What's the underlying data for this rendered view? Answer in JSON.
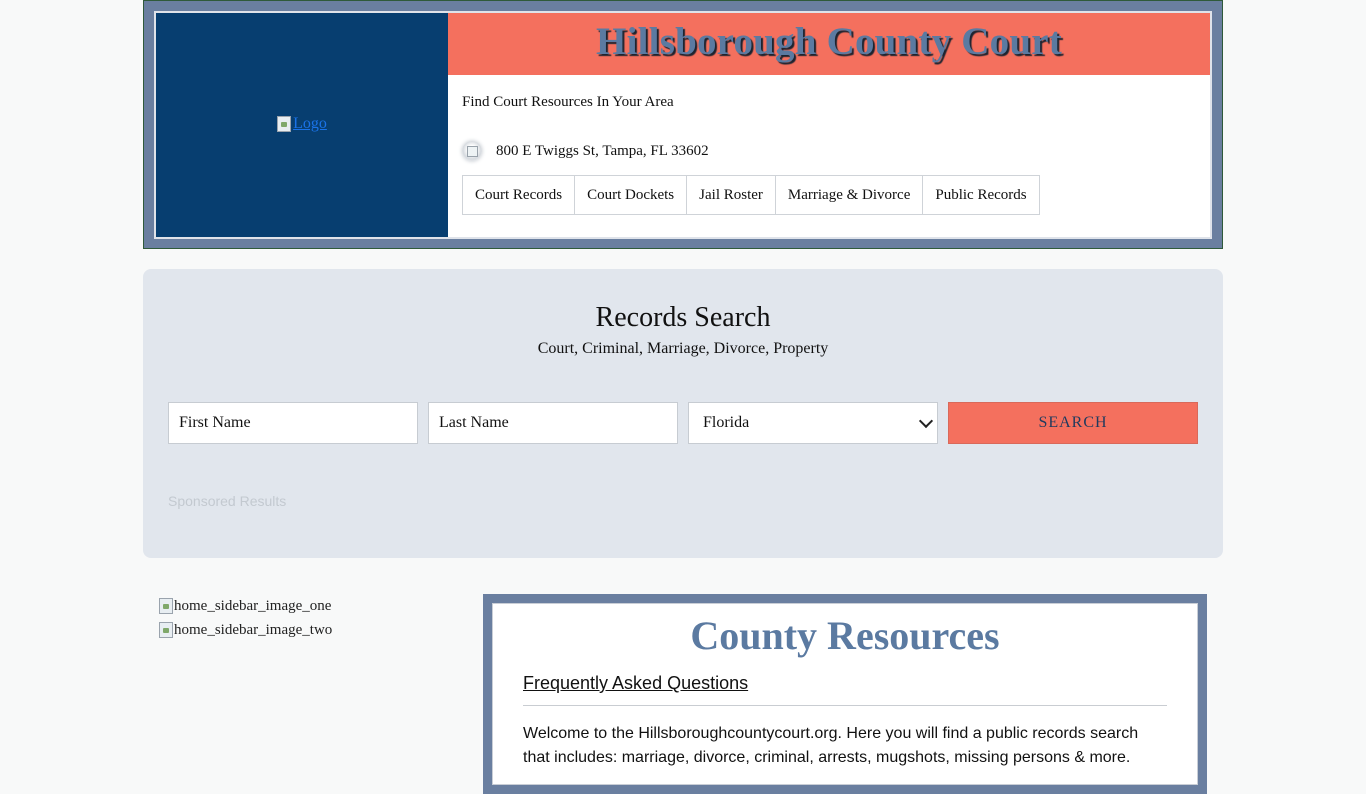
{
  "header": {
    "logo_alt": "Logo",
    "site_title": "Hillsborough County Court",
    "tagline": "Find Court Resources In Your Area",
    "address": "800 E Twiggs St, Tampa, FL 33602",
    "nav": [
      "Court Records",
      "Court Dockets",
      "Jail Roster",
      "Marriage & Divorce",
      "Public Records"
    ]
  },
  "search": {
    "title": "Records Search",
    "subtitle": "Court, Criminal, Marriage, Divorce, Property",
    "first_name_placeholder": "First Name",
    "last_name_placeholder": "Last Name",
    "state_selected": "Florida",
    "button_label": "SEARCH",
    "sponsored": "Sponsored Results"
  },
  "sidebar": {
    "images": [
      "home_sidebar_image_one",
      "home_sidebar_image_two"
    ]
  },
  "resources": {
    "title": "County Resources",
    "faq_link": "Frequently Asked Questions",
    "welcome_text": "Welcome to the Hillsboroughcountycourt.org. Here you will find a public records search that includes: marriage, divorce, criminal, arrests, mugshots, missing persons & more."
  },
  "colors": {
    "accent_salmon": "#f4705e",
    "navy": "#073e70",
    "slate_blue": "#5b7aa1",
    "frame": "#6a7fa0"
  }
}
